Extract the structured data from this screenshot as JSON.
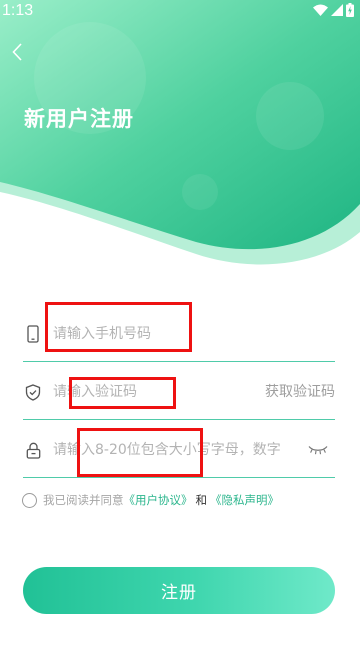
{
  "status_bar": {
    "time": "1:13",
    "icons": [
      "wifi-icon",
      "signal-icon",
      "battery-charging-icon"
    ]
  },
  "header": {
    "back_icon": "chevron-left-icon",
    "title": "新用户注册",
    "colors": {
      "gradient_start": "#8fe9c3",
      "gradient_end": "#21b985",
      "wave_light": "#b4efd6"
    }
  },
  "form": {
    "phone": {
      "icon": "phone-icon",
      "value": "",
      "placeholder": "请输入手机号码"
    },
    "code": {
      "icon": "shield-icon",
      "value": "",
      "placeholder": "请输入验证码",
      "action_label": "获取验证码"
    },
    "password": {
      "icon": "lock-icon",
      "value": "",
      "placeholder": "请输入8-20位包含大小写字母，数字",
      "toggle_icon": "eye-closed-icon"
    }
  },
  "agreement": {
    "prefix": "我已阅读并同意",
    "user_agreement": "《用户协议》",
    "and": "和",
    "privacy": "《隐私声明》"
  },
  "submit": {
    "label": "注册"
  },
  "colors": {
    "accent": "#2cb68d",
    "divider": "#4fcba9",
    "annotation_box": "#ee1111"
  }
}
